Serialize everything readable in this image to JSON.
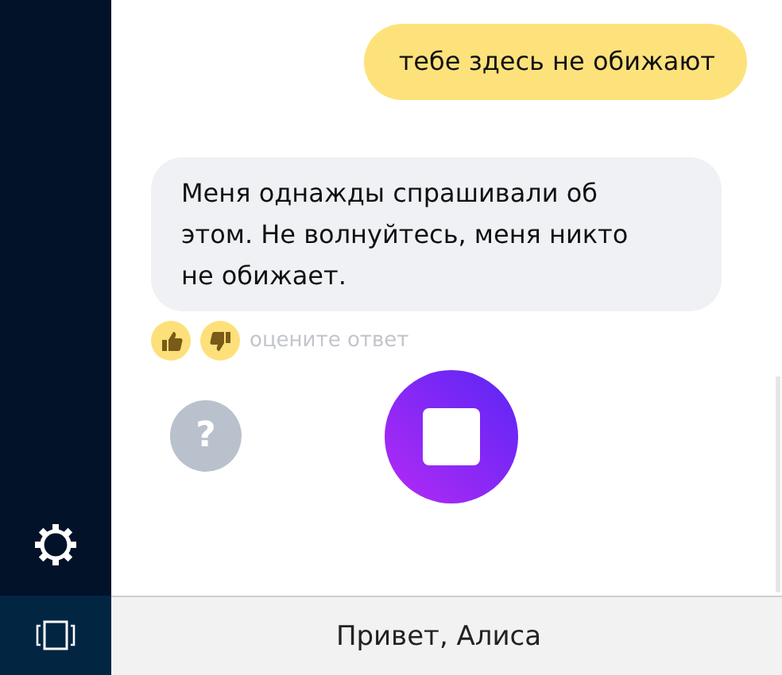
{
  "messages": [
    {
      "kind": "user",
      "text": "тебе здесь не обижают"
    },
    {
      "kind": "assistant",
      "text": "Меня однажды спрашивали об этом. Не волнуйтесь, меня никто не обижает."
    }
  ],
  "rating": {
    "label": "оцените ответ"
  },
  "help_button": {
    "label": "?"
  },
  "search": {
    "value": "Привет, Алиса"
  }
}
